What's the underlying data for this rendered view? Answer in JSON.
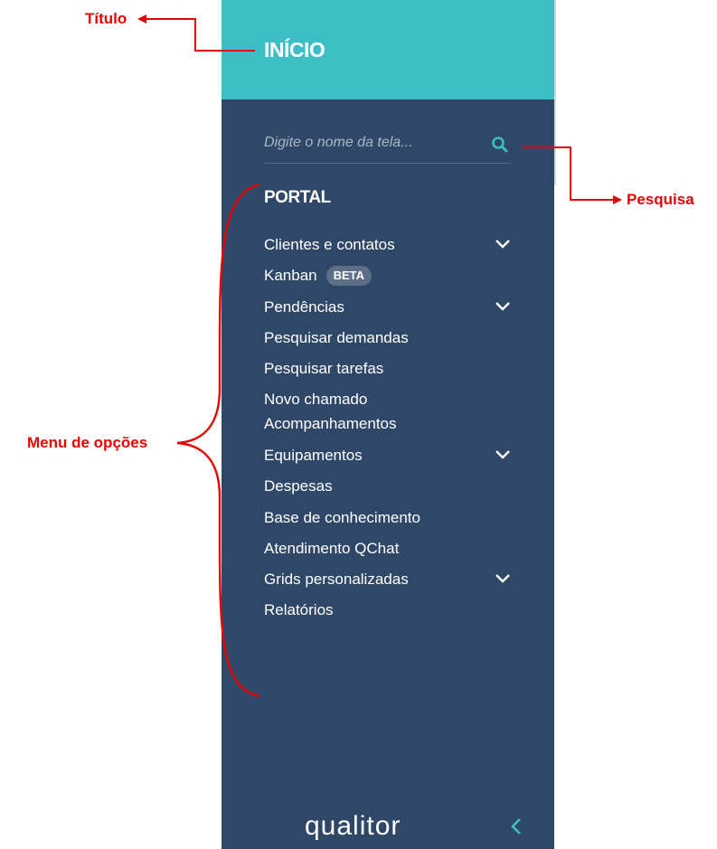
{
  "sidebar": {
    "title": "INÍCIO",
    "search": {
      "placeholder": "Digite o nome da tela...",
      "value": ""
    },
    "section": "PORTAL",
    "items": [
      {
        "label": "Clientes e contatos",
        "expandable": true
      },
      {
        "label": "Kanban",
        "badge": "BETA",
        "expandable": false
      },
      {
        "label": "Pendências",
        "expandable": true
      },
      {
        "label": "Pesquisar demandas",
        "expandable": false
      },
      {
        "label": "Pesquisar tarefas",
        "expandable": false
      },
      {
        "label": "Novo chamado",
        "expandable": false
      },
      {
        "label": "Acompanhamentos",
        "expandable": false
      },
      {
        "label": "Equipamentos",
        "expandable": true
      },
      {
        "label": "Despesas",
        "expandable": false
      },
      {
        "label": "Base de conhecimento",
        "expandable": false
      },
      {
        "label": "Atendimento QChat",
        "expandable": false
      },
      {
        "label": "Grids personalizadas",
        "expandable": true
      },
      {
        "label": "Relatórios",
        "expandable": false
      }
    ],
    "logo": "qualitor",
    "icons": {
      "search": "search-icon",
      "chevron": "chevron-down-icon",
      "collapse": "chevron-left-icon"
    },
    "colors": {
      "header": "#3bbfc4",
      "panel": "#304867",
      "accent": "#3bbfc4"
    }
  },
  "annotations": {
    "title_label": "Título",
    "search_label": "Pesquisa",
    "menu_label": "Menu de opções",
    "color": "#e60000"
  }
}
